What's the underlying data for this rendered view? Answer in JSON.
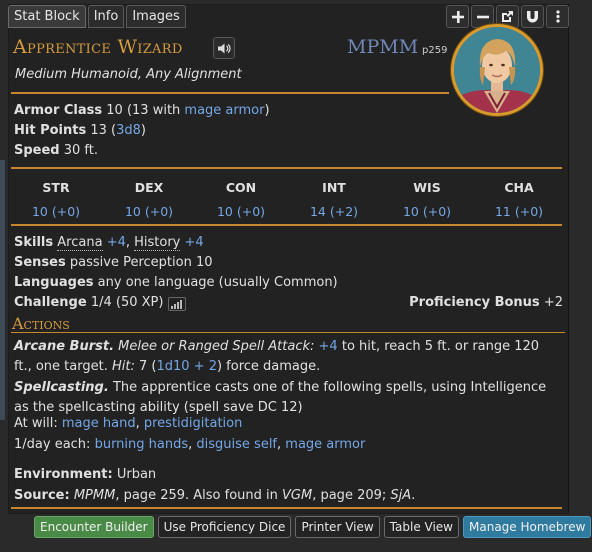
{
  "tabs": [
    {
      "label": "Stat Block",
      "active": true
    },
    {
      "label": "Info",
      "active": false
    },
    {
      "label": "Images",
      "active": false
    }
  ],
  "toolbar_icons": [
    "plus-icon",
    "minus-icon",
    "popout-icon",
    "magnet-icon",
    "more-vertical-icon"
  ],
  "creature": {
    "name": "Apprentice Wizard",
    "source_abbr": "MPMM",
    "source_page": "p259",
    "subtitle": "Medium Humanoid, Any Alignment"
  },
  "stats": {
    "ac_label": "Armor Class",
    "ac_value": "10 (13 with ",
    "ac_link": "mage armor",
    "ac_end": ")",
    "hp_label": "Hit Points",
    "hp_value": "13 (",
    "hp_link": "3d8",
    "hp_end": ")",
    "speed_label": "Speed",
    "speed_value": "30 ft."
  },
  "abilities": [
    {
      "name": "STR",
      "value": "10 (+0)"
    },
    {
      "name": "DEX",
      "value": "10 (+0)"
    },
    {
      "name": "CON",
      "value": "10 (+0)"
    },
    {
      "name": "INT",
      "value": "14 (+2)"
    },
    {
      "name": "WIS",
      "value": "10 (+0)"
    },
    {
      "name": "CHA",
      "value": "11 (+0)"
    }
  ],
  "traits": {
    "skills_label": "Skills",
    "skill1": "Arcana",
    "skill1_bonus": "+4",
    "skill_sep": ", ",
    "skill2": "History",
    "skill2_bonus": "+4",
    "senses_label": "Senses",
    "senses_value": "passive Perception 10",
    "languages_label": "Languages",
    "languages_value": "any one language (usually Common)",
    "challenge_label": "Challenge",
    "challenge_value": "1/4 (50 XP)",
    "prof_label": "Proficiency Bonus",
    "prof_value": "+2"
  },
  "actions": {
    "heading": "Actions",
    "a1_name": "Arcane Burst.",
    "a1_type": "Melee or Ranged Spell Attack:",
    "a1_bonus": "+4",
    "a1_text1": "to hit, reach 5 ft. or range 120 ft., one target.",
    "a1_hit": "Hit:",
    "a1_text2": "7 (",
    "a1_dice": "1d10 + 2",
    "a1_text3": ") force damage.",
    "a2_name": "Spellcasting.",
    "a2_text": "The apprentice casts one of the following spells, using Intelligence as the spellcasting ability (spell save DC 12)",
    "at_will_label": "At will:",
    "spell1": "mage hand",
    "spell_sep": ", ",
    "spell2": "prestidigitation",
    "daily_label": "1/day each:",
    "spell3": "burning hands",
    "spell4": "disguise self",
    "spell5": "mage armor"
  },
  "environment": {
    "label": "Environment:",
    "value": "Urban"
  },
  "source": {
    "label": "Source:",
    "book1": "MPMM",
    "text1": ", page 259. Also found in ",
    "book2": "VGM",
    "text2": ", page 209; ",
    "book3": "SjA",
    "text3": "."
  },
  "footer_buttons": [
    "Encounter Builder",
    "Use Proficiency Dice",
    "Printer View",
    "Table View",
    "Manage Homebrew"
  ],
  "colors": {
    "accent": "#d59b40",
    "link": "#74a7e6",
    "green_button": "#4a8a47",
    "teal_button": "#2f7ba0"
  }
}
